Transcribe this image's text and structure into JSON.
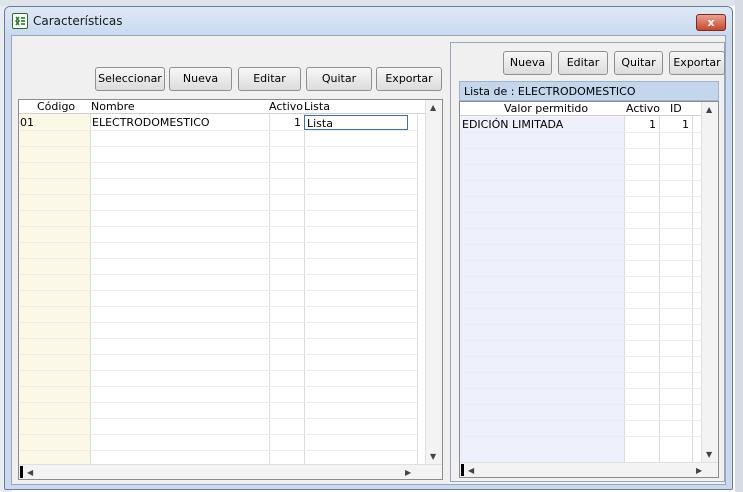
{
  "window": {
    "title": "Características",
    "close_label": "x"
  },
  "left": {
    "buttons": {
      "select": "Seleccionar",
      "new": "Nueva",
      "edit": "Editar",
      "remove": "Quitar",
      "export": "Exportar"
    },
    "columns": [
      "Código",
      "Nombre",
      "Activo",
      "Lista"
    ],
    "rows": [
      {
        "codigo": "01",
        "nombre": "ELECTRODOMESTICO",
        "activo": "1",
        "lista": "Lista"
      }
    ]
  },
  "right": {
    "buttons": {
      "new": "Nueva",
      "edit": "Editar",
      "remove": "Quitar",
      "export": "Exportar"
    },
    "list_title": "Lista de : ELECTRODOMESTICO",
    "columns": [
      "Valor permitido",
      "Activo",
      "ID"
    ],
    "rows": [
      {
        "valor": "EDICIÓN LIMITADA",
        "activo": "1",
        "id": "1"
      }
    ]
  },
  "colors": {
    "title_bg": "#c9daf0",
    "close_red": "#c8472c",
    "code_column": "#fbf9e6",
    "value_column": "#eef0fb",
    "list_title_bg": "#c3d6ec"
  }
}
